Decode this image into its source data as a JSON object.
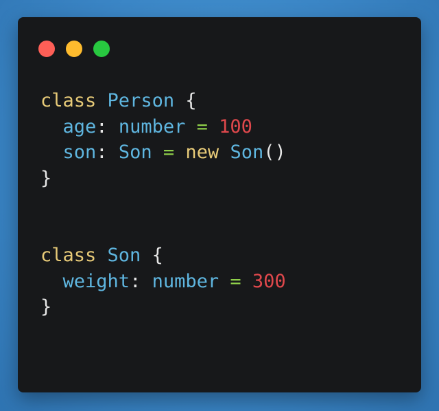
{
  "window": {
    "controls": [
      "close",
      "minimize",
      "maximize"
    ]
  },
  "code": {
    "lines": [
      [
        {
          "t": "class",
          "c": "kw"
        },
        {
          "t": " ",
          "c": "punc"
        },
        {
          "t": "Person",
          "c": "name"
        },
        {
          "t": " {",
          "c": "punc"
        }
      ],
      [
        {
          "t": "  ",
          "c": "punc"
        },
        {
          "t": "age",
          "c": "prop"
        },
        {
          "t": ": ",
          "c": "punc"
        },
        {
          "t": "number",
          "c": "type"
        },
        {
          "t": " ",
          "c": "punc"
        },
        {
          "t": "=",
          "c": "op"
        },
        {
          "t": " ",
          "c": "punc"
        },
        {
          "t": "100",
          "c": "num"
        }
      ],
      [
        {
          "t": "  ",
          "c": "punc"
        },
        {
          "t": "son",
          "c": "prop"
        },
        {
          "t": ": ",
          "c": "punc"
        },
        {
          "t": "Son",
          "c": "type"
        },
        {
          "t": " ",
          "c": "punc"
        },
        {
          "t": "=",
          "c": "op"
        },
        {
          "t": " ",
          "c": "punc"
        },
        {
          "t": "new",
          "c": "kw"
        },
        {
          "t": " ",
          "c": "punc"
        },
        {
          "t": "Son",
          "c": "type"
        },
        {
          "t": "()",
          "c": "punc"
        }
      ],
      [
        {
          "t": "}",
          "c": "punc"
        }
      ],
      [],
      [],
      [
        {
          "t": "class",
          "c": "kw"
        },
        {
          "t": " ",
          "c": "punc"
        },
        {
          "t": "Son",
          "c": "name"
        },
        {
          "t": " {",
          "c": "punc"
        }
      ],
      [
        {
          "t": "  ",
          "c": "punc"
        },
        {
          "t": "weight",
          "c": "prop"
        },
        {
          "t": ": ",
          "c": "punc"
        },
        {
          "t": "number",
          "c": "type"
        },
        {
          "t": " ",
          "c": "punc"
        },
        {
          "t": "=",
          "c": "op"
        },
        {
          "t": " ",
          "c": "punc"
        },
        {
          "t": "300",
          "c": "num"
        }
      ],
      [
        {
          "t": "}",
          "c": "punc"
        }
      ]
    ]
  },
  "colors": {
    "keyword": "#e7ca78",
    "identifier": "#5fb6e0",
    "number": "#e0484c",
    "operator": "#8fcf4a",
    "punctuation": "#e7e7e7",
    "editor_background": "#17181a",
    "page_background": "#3b86c6"
  }
}
